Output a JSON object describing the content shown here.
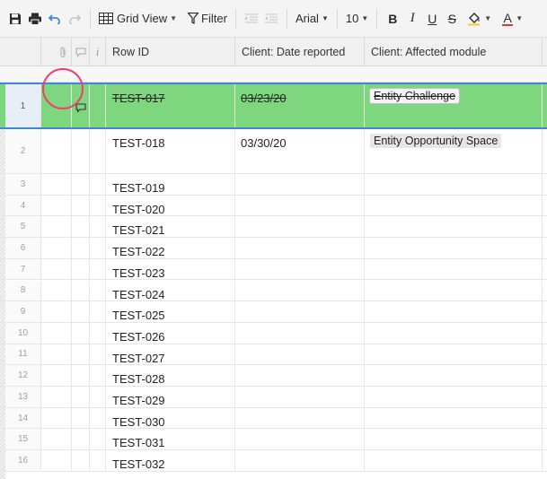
{
  "toolbar": {
    "grid_view_label": "Grid View",
    "filter_label": "Filter",
    "font_name": "Arial",
    "font_size": "10",
    "bold": "B",
    "italic": "I",
    "underline": "U",
    "strikethrough": "S",
    "text_color": "A"
  },
  "columns": {
    "row_id": "Row ID",
    "date_reported": "Client: Date reported",
    "affected_module": "Client: Affected module",
    "info": "i"
  },
  "rows": [
    {
      "num": "1",
      "id": "TEST-017",
      "date": "03/23/20",
      "module": "Entity Challenge"
    },
    {
      "num": "2",
      "id": "TEST-018",
      "date": "03/30/20",
      "module": "Entity Opportunity Space"
    },
    {
      "num": "3",
      "id": "TEST-019"
    },
    {
      "num": "4",
      "id": "TEST-020"
    },
    {
      "num": "5",
      "id": "TEST-021"
    },
    {
      "num": "6",
      "id": "TEST-022"
    },
    {
      "num": "7",
      "id": "TEST-023"
    },
    {
      "num": "8",
      "id": "TEST-024"
    },
    {
      "num": "9",
      "id": "TEST-025"
    },
    {
      "num": "10",
      "id": "TEST-026"
    },
    {
      "num": "11",
      "id": "TEST-027"
    },
    {
      "num": "12",
      "id": "TEST-028"
    },
    {
      "num": "13",
      "id": "TEST-029"
    },
    {
      "num": "14",
      "id": "TEST-030"
    },
    {
      "num": "15",
      "id": "TEST-031"
    },
    {
      "num": "16",
      "id": "TEST-032"
    }
  ],
  "colors": {
    "selected_row": "#7ed67e",
    "selection_border": "#3f86d8",
    "highlight_circle": "#ef3f6a"
  }
}
